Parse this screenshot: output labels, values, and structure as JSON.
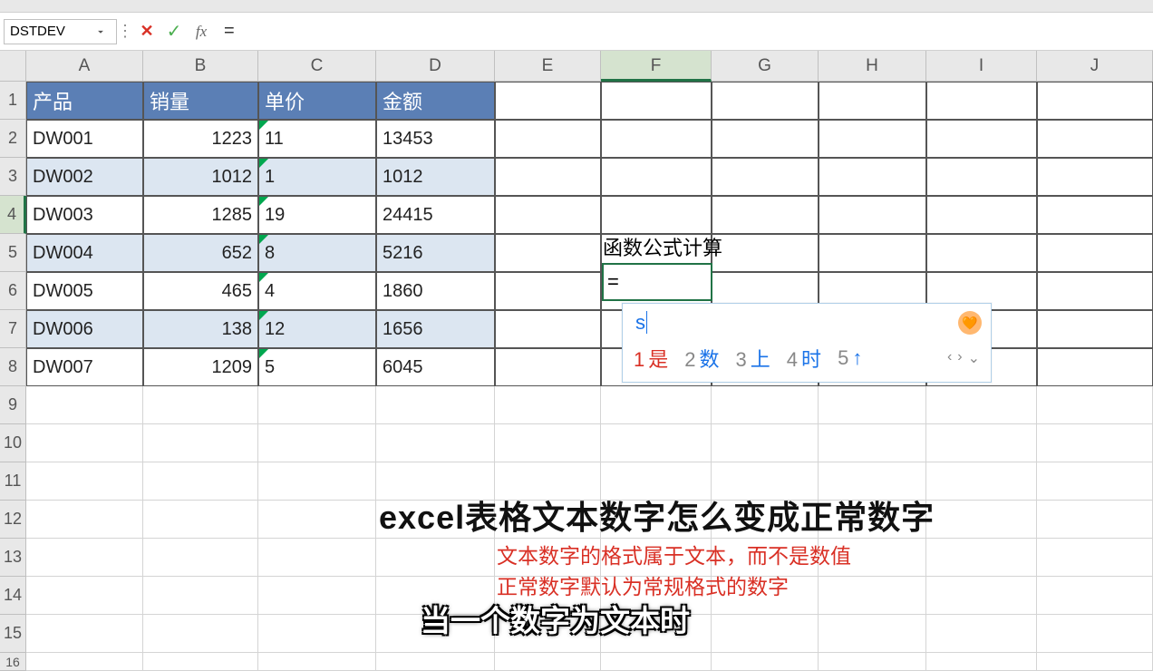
{
  "name_box": "DSTDEV",
  "formula_input": "=",
  "columns": [
    "A",
    "B",
    "C",
    "D",
    "E",
    "F",
    "G",
    "H",
    "I",
    "J"
  ],
  "selected_column": "F",
  "selected_row": 4,
  "table": {
    "headers": [
      "产品",
      "销量",
      "单价",
      "金额"
    ],
    "rows": [
      {
        "p": "DW001",
        "s": "1223",
        "u": "11",
        "a": "13453"
      },
      {
        "p": "DW002",
        "s": "1012",
        "u": "1",
        "a": "1012"
      },
      {
        "p": "DW003",
        "s": "1285",
        "u": "19",
        "a": "24415"
      },
      {
        "p": "DW004",
        "s": "652",
        "u": "8",
        "a": "5216"
      },
      {
        "p": "DW005",
        "s": "465",
        "u": "4",
        "a": "1860"
      },
      {
        "p": "DW006",
        "s": "138",
        "u": "12",
        "a": "1656"
      },
      {
        "p": "DW007",
        "s": "1209",
        "u": "5",
        "a": "6045"
      }
    ]
  },
  "f3_label": "函数公式计算",
  "f4_value": "=",
  "ime": {
    "input": "s",
    "candidates": [
      {
        "n": "1",
        "w": "是"
      },
      {
        "n": "2",
        "w": "数"
      },
      {
        "n": "3",
        "w": "上"
      },
      {
        "n": "4",
        "w": "时"
      },
      {
        "n": "5",
        "w": "↑"
      }
    ]
  },
  "big_title": "excel表格文本数字怎么变成正常数字",
  "red_line1": "文本数字的格式属于文本，而不是数值",
  "red_line2": "正常数字默认为常规格式的数字",
  "caption": "当一个数字为文本时"
}
